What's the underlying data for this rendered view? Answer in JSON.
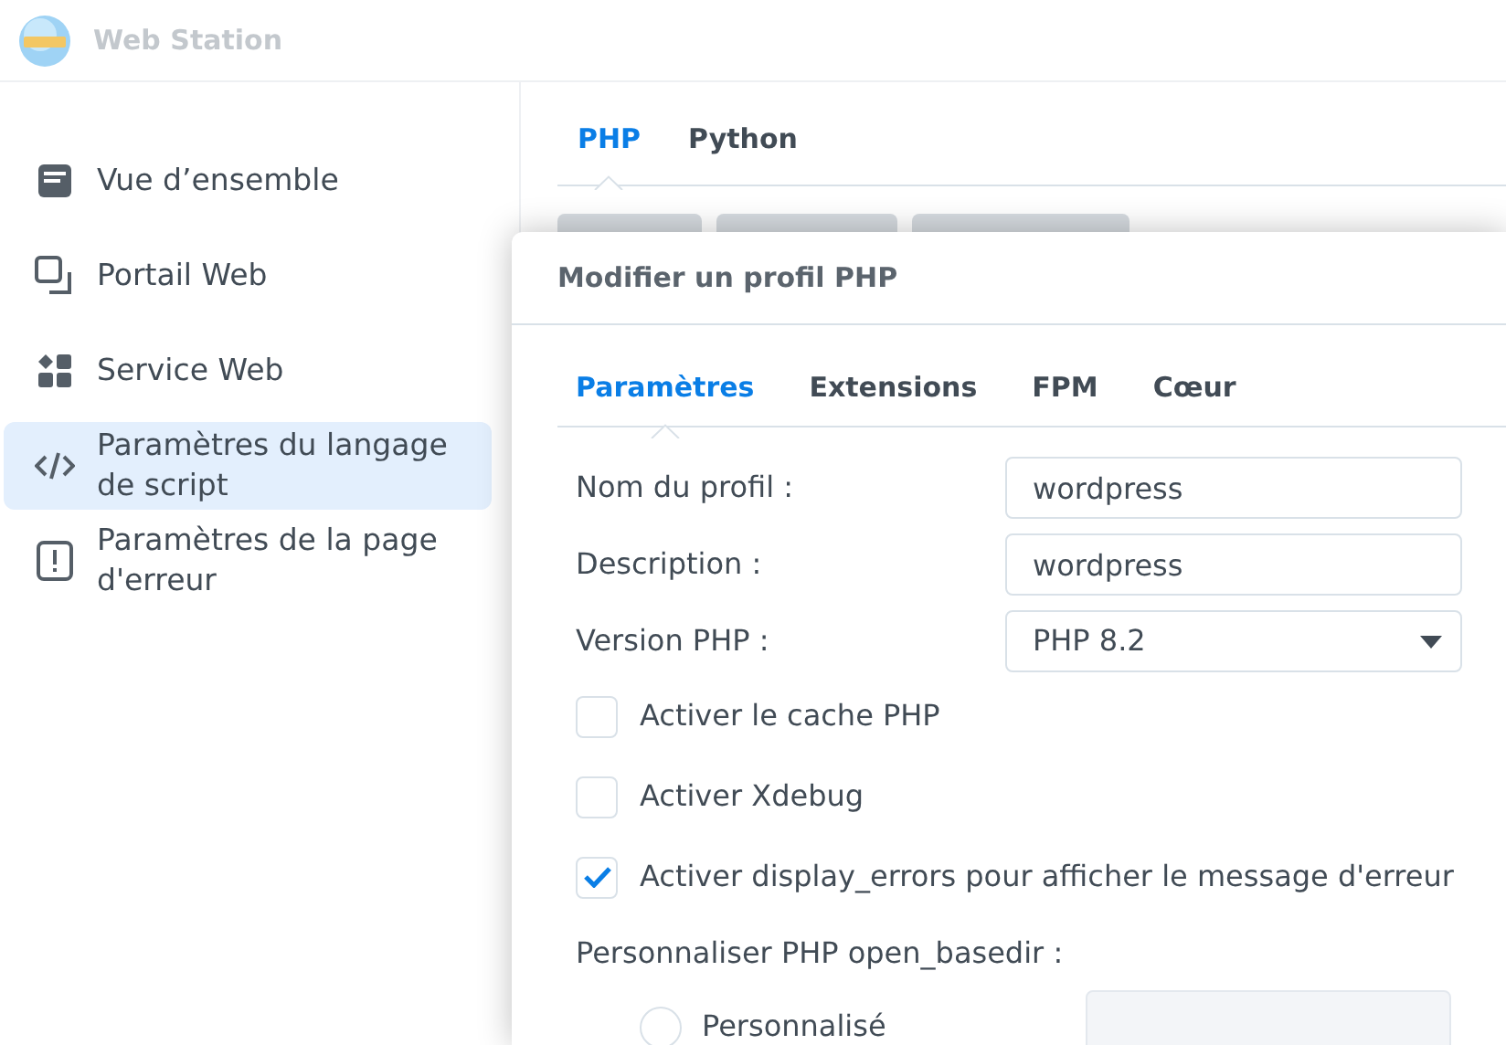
{
  "app": {
    "title": "Web Station"
  },
  "sidebar": {
    "items": [
      {
        "label": "Vue d’ensemble",
        "kind": "overview",
        "selected": false
      },
      {
        "label": "Portail Web",
        "kind": "portal",
        "selected": false
      },
      {
        "label": "Service Web",
        "kind": "service",
        "selected": false
      },
      {
        "label": "Paramètres du langage de script",
        "kind": "code",
        "selected": true
      },
      {
        "label": "Paramètres de la page d'erreur",
        "kind": "error",
        "selected": false
      }
    ]
  },
  "tabs": [
    {
      "label": "PHP",
      "selected": true
    },
    {
      "label": "Python",
      "selected": false
    }
  ],
  "dialog": {
    "title": "Modifier un profil PHP",
    "tabs": [
      {
        "label": "Paramètres",
        "selected": true
      },
      {
        "label": "Extensions",
        "selected": false
      },
      {
        "label": "FPM",
        "selected": false
      },
      {
        "label": "Cœur",
        "selected": false
      }
    ],
    "fields": [
      {
        "kind": "text",
        "label": "Nom du profil :",
        "value": "wordpress"
      },
      {
        "kind": "text",
        "label": "Description :",
        "value": "wordpress"
      },
      {
        "kind": "select",
        "label": "Version PHP :",
        "value": "PHP 8.2"
      }
    ],
    "checkboxes": [
      {
        "label": "Activer le cache PHP",
        "checked": false
      },
      {
        "label": "Activer Xdebug",
        "checked": false
      },
      {
        "label": "Activer display_errors pour afficher le message d'erreur",
        "checked": true
      }
    ],
    "basedir": {
      "label": "Personnaliser PHP open_basedir :",
      "options": [
        {
          "label": "Personnalisé",
          "selected": false
        }
      ]
    }
  }
}
